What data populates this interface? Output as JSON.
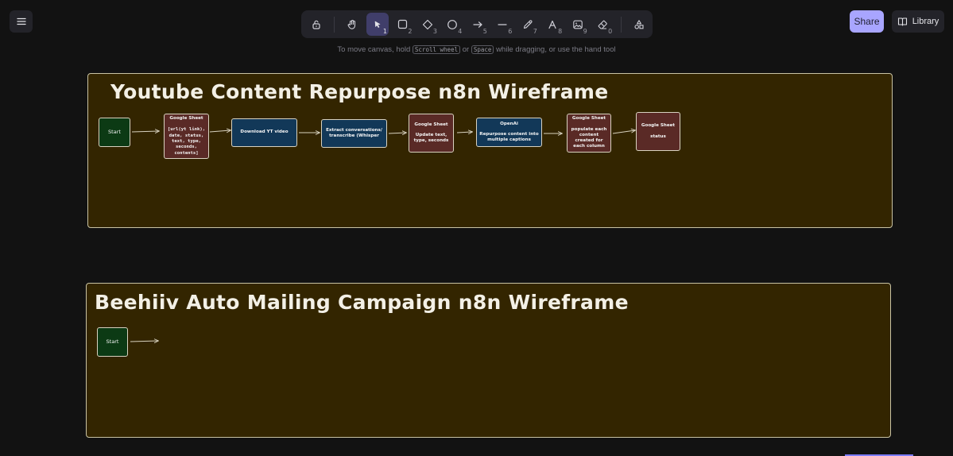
{
  "toolbar": {
    "tools": [
      {
        "name": "lock",
        "key": ""
      },
      {
        "name": "hand",
        "key": ""
      },
      {
        "name": "selection",
        "key": "1"
      },
      {
        "name": "rectangle",
        "key": "2"
      },
      {
        "name": "diamond",
        "key": "3"
      },
      {
        "name": "ellipse",
        "key": "4"
      },
      {
        "name": "arrow",
        "key": "5"
      },
      {
        "name": "line",
        "key": "6"
      },
      {
        "name": "draw",
        "key": "7"
      },
      {
        "name": "text",
        "key": "8"
      },
      {
        "name": "image",
        "key": "9"
      },
      {
        "name": "eraser",
        "key": "0"
      },
      {
        "name": "more-tools",
        "key": ""
      }
    ]
  },
  "header": {
    "share_label": "Share",
    "library_label": "Library"
  },
  "hint": {
    "part1": "To move canvas, hold",
    "key1": "Scroll wheel",
    "part2": "or",
    "key2": "Space",
    "part3": "while dragging, or use the hand tool"
  },
  "frames": {
    "youtube": {
      "title": "Youtube Content Repurpose n8n Wireframe",
      "nodes": {
        "start": "Start",
        "sheet1_title": "Google Sheet",
        "sheet1_body": "[url(yt link), date, status, text, type, seconds, contents]",
        "download": "Download YT video",
        "extract": "Extract conversations/ transcribe (Whisper",
        "sheet2_title": "Google Sheet",
        "sheet2_body": "Update text, type, seconds",
        "openai_title": "OpenAi",
        "openai_body": "Repurpose content into multiple captions",
        "sheet3_title": "Google Sheet",
        "sheet3_body": "populate each content created for each column",
        "sheet4_title": "Google Sheet",
        "sheet4_body": "status"
      }
    },
    "beehiiv": {
      "title": "Beehiiv Auto Mailing Campaign n8n Wireframe",
      "nodes": {
        "start": "Start"
      }
    }
  },
  "colors": {
    "canvas": "#121212",
    "frame_fill": "#332500",
    "accent": "#a8a5ff",
    "start_fill": "#0c3a14",
    "sheet_fill": "#5a2a26",
    "action_fill": "#123858"
  }
}
